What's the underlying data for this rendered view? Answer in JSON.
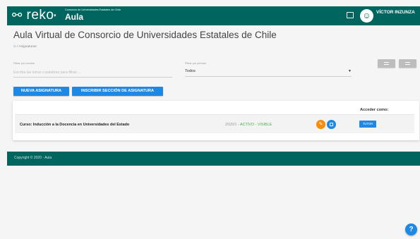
{
  "header": {
    "logo_text": "reko",
    "logo_icon": "link-chain-icon",
    "logo_caret": "▾",
    "brand_subtitle": "Consorcio de Universidades Estatales de Chile",
    "brand_title": "Aula",
    "fullscreen_icon": "fullscreen-icon",
    "avatar_icon": "smiley-avatar-icon",
    "user_name": "VÍCTOR INZUNZA",
    "user_caret": "▾"
  },
  "page": {
    "title": "Aula Virtual de Consorcio de Universidades Estatales de Chile",
    "breadcrumb_icon": "home-icon",
    "breadcrumb_separator": "/",
    "breadcrumb_current": "Asignaturas"
  },
  "filters": {
    "name_label": "Filtrar por nombre",
    "name_placeholder": "Escriba las letras o palabras para filtrar...",
    "name_value": "",
    "period_label": "Filtrar por periodo",
    "period_value": "Todos"
  },
  "view_toggle": {
    "icons": [
      "view-list-icon",
      "view-list-icon"
    ]
  },
  "actions": {
    "new_course": "NUEVA ASIGNATURA",
    "enroll_section": "INSCRIBIR SECCIÓN DE ASIGNATURA"
  },
  "courses": {
    "access_header": "Acceder como:",
    "items": [
      {
        "name": "Curso: Inducción a la Docencia en Universidades del Estado",
        "period": "2020/1",
        "status_sep": " - ",
        "status": "ACTIVO - VISIBLE",
        "edit_icon": "pencil-icon",
        "copy_icon": "copy-icon",
        "access_button": "TUTOR"
      }
    ]
  },
  "footer": {
    "copyright": "Copyright © 2020 - Aula"
  },
  "help": {
    "icon": "help-icon",
    "glyph": "?"
  },
  "colors": {
    "primary_teal": "#00645f",
    "accent_blue": "#1e88e5",
    "edit_orange": "#fb8c00",
    "status_green": "#4caf50"
  }
}
